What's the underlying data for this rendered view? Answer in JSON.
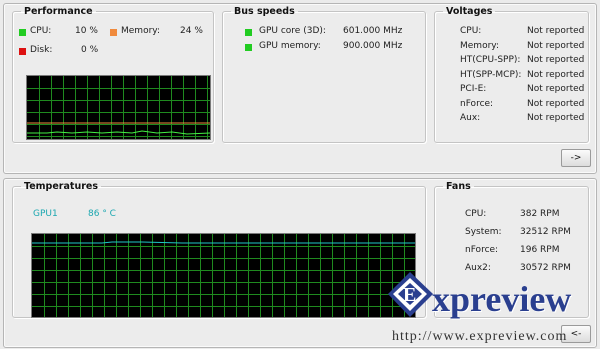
{
  "performance": {
    "title": "Performance",
    "cpu_label": "CPU:",
    "cpu_value": "10 %",
    "memory_label": "Memory:",
    "memory_value": "24 %",
    "disk_label": "Disk:",
    "disk_value": "0 %",
    "colors": {
      "cpu": "#22cc22",
      "memory": "#f08a3c",
      "disk": "#dd1111"
    }
  },
  "bus_speeds": {
    "title": "Bus speeds",
    "items": [
      {
        "label": "GPU core (3D):",
        "value": "601.000 MHz"
      },
      {
        "label": "GPU memory:",
        "value": "900.000 MHz"
      }
    ],
    "color": "#22cc22"
  },
  "voltages": {
    "title": "Voltages",
    "items": [
      {
        "label": "CPU:",
        "value": "Not reported"
      },
      {
        "label": "Memory:",
        "value": "Not reported"
      },
      {
        "label": "HT(CPU-SPP):",
        "value": "Not reported"
      },
      {
        "label": "HT(SPP-MCP):",
        "value": "Not reported"
      },
      {
        "label": "PCI-E:",
        "value": "Not reported"
      },
      {
        "label": "nForce:",
        "value": "Not reported"
      },
      {
        "label": "Aux:",
        "value": "Not reported"
      }
    ]
  },
  "expand_button": "->",
  "temperatures": {
    "title": "Temperatures",
    "sensor_label": "GPU1",
    "sensor_value": "86 ° C",
    "color": "#1ba7b0"
  },
  "fans": {
    "title": "Fans",
    "items": [
      {
        "label": "CPU:",
        "value": "382 RPM"
      },
      {
        "label": "System:",
        "value": "32512 RPM"
      },
      {
        "label": "nForce:",
        "value": "196 RPM"
      },
      {
        "label": "Aux2:",
        "value": "30572 RPM"
      }
    ]
  },
  "collapse_button": "<-",
  "watermark": {
    "brand": "xpreview",
    "url": "http://www.expreview.com"
  }
}
